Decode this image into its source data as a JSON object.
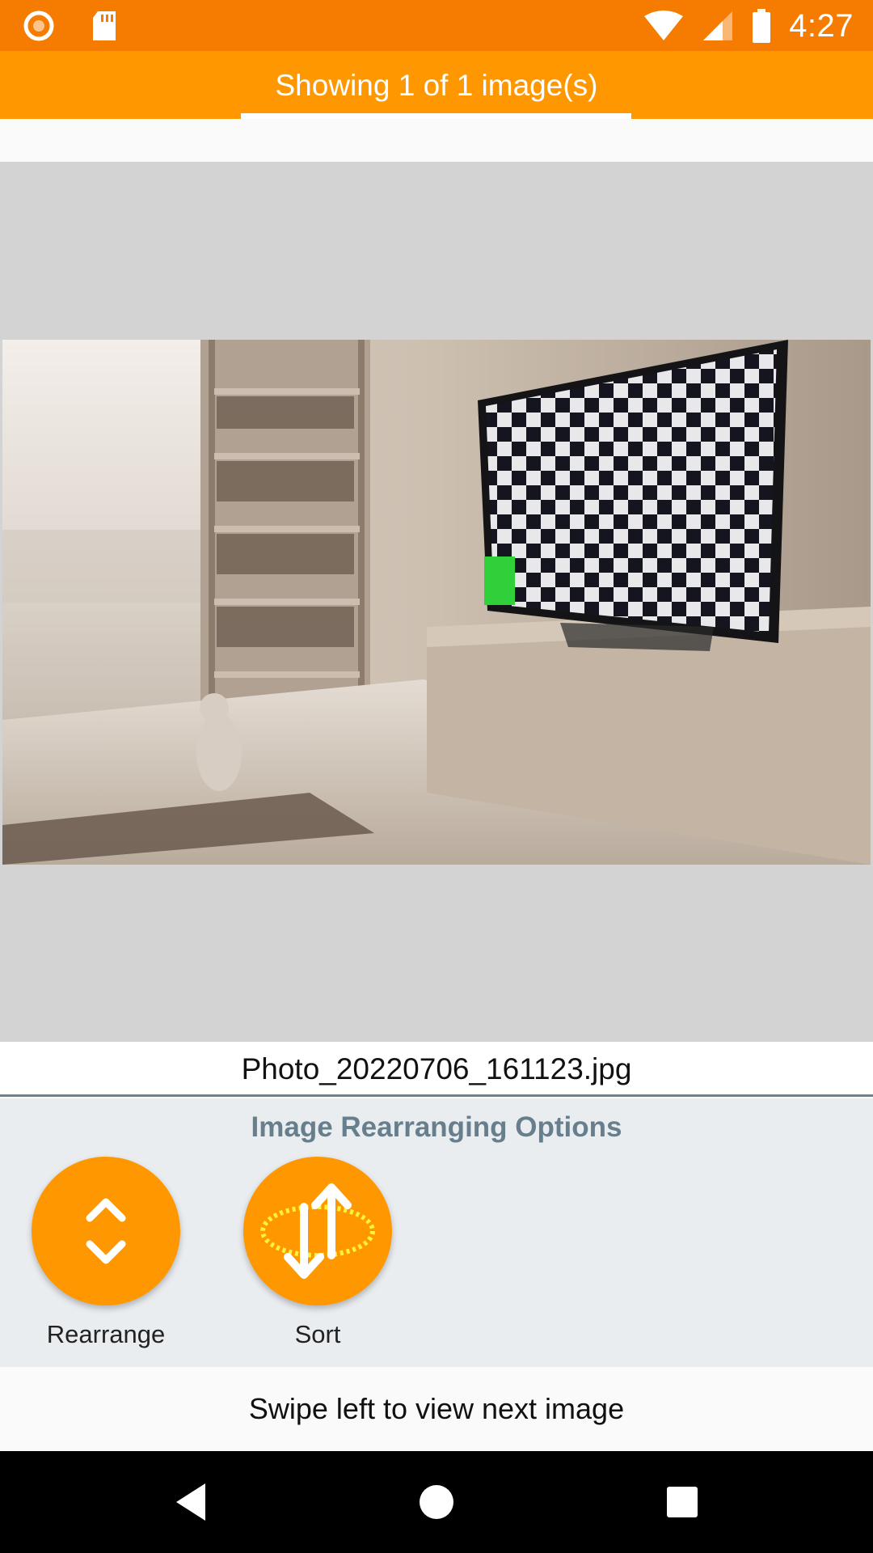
{
  "status_bar": {
    "time": "4:27",
    "icons": [
      "record-icon",
      "sd-card-icon",
      "wifi-icon",
      "cell-signal-icon",
      "battery-icon"
    ]
  },
  "tabs": {
    "active_label": "Showing 1 of 1 image(s)"
  },
  "viewer": {
    "image_description_icon": "photo-living-room-tv-checkerboard"
  },
  "file": {
    "name": "Photo_20220706_161123.jpg"
  },
  "options": {
    "title": "Image Rearranging Options",
    "buttons": [
      {
        "label": "Rearrange",
        "icon": "chevron-up-down-icon"
      },
      {
        "label": "Sort",
        "icon": "sort-arrows-icon"
      }
    ]
  },
  "hint": {
    "text": "Swipe left to view next image"
  },
  "nav_bar": {
    "buttons": [
      "back-icon",
      "home-icon",
      "recents-icon"
    ]
  },
  "colors": {
    "status_bar": "#f57c00",
    "tab_bar": "#ff9800",
    "accent": "#ff9800",
    "options_title": "#677f8d",
    "options_bg": "#eaedf0"
  }
}
